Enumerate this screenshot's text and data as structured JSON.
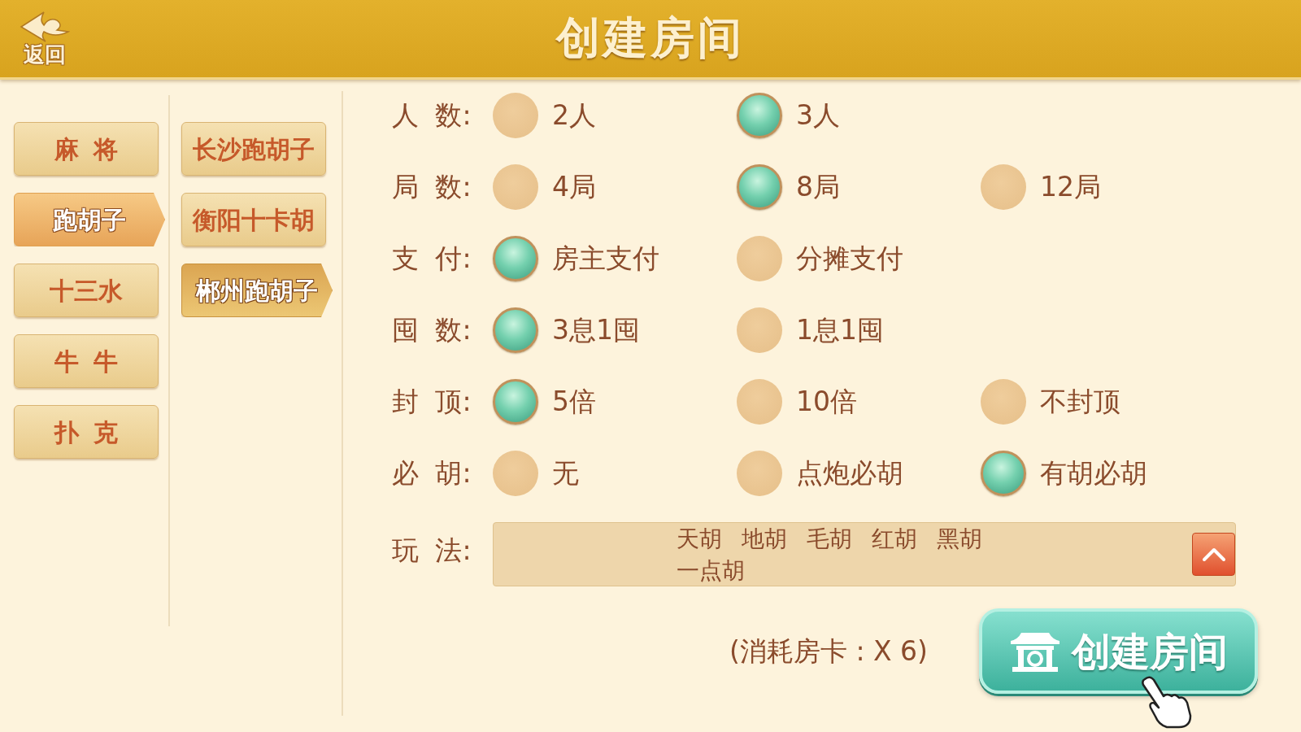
{
  "header": {
    "back_label": "返回",
    "title": "创建房间"
  },
  "categories": [
    {
      "label": "麻 将",
      "selected": false
    },
    {
      "label": "跑胡子",
      "selected": true
    },
    {
      "label": "十三水",
      "selected": false
    },
    {
      "label": "牛 牛",
      "selected": false
    },
    {
      "label": "扑 克",
      "selected": false
    }
  ],
  "variants": [
    {
      "label": "长沙跑胡子",
      "selected": false
    },
    {
      "label": "衡阳十卡胡",
      "selected": false
    },
    {
      "label": "郴州跑胡子",
      "selected": true
    }
  ],
  "options": [
    {
      "label": "人 数:",
      "choices": [
        {
          "label": "2人",
          "selected": false
        },
        {
          "label": "3人",
          "selected": true
        }
      ]
    },
    {
      "label": "局 数:",
      "choices": [
        {
          "label": "4局",
          "selected": false
        },
        {
          "label": "8局",
          "selected": true
        },
        {
          "label": "12局",
          "selected": false
        }
      ]
    },
    {
      "label": "支 付:",
      "choices": [
        {
          "label": "房主支付",
          "selected": true
        },
        {
          "label": "分摊支付",
          "selected": false
        }
      ]
    },
    {
      "label": "囤 数:",
      "choices": [
        {
          "label": "3息1囤",
          "selected": true
        },
        {
          "label": "1息1囤",
          "selected": false
        }
      ]
    },
    {
      "label": "封 顶:",
      "choices": [
        {
          "label": "5倍",
          "selected": true
        },
        {
          "label": "10倍",
          "selected": false
        },
        {
          "label": "不封顶",
          "selected": false
        }
      ]
    },
    {
      "label": "必 胡:",
      "choices": [
        {
          "label": "无",
          "selected": false
        },
        {
          "label": "点炮必胡",
          "selected": false
        },
        {
          "label": "有胡必胡",
          "selected": true
        }
      ]
    }
  ],
  "play_rules": {
    "label": "玩 法:",
    "items": [
      "天胡",
      "地胡",
      "毛胡",
      "红胡",
      "黑胡",
      "一点胡"
    ]
  },
  "cost_note": "(消耗房卡 : X 6)",
  "create_button": {
    "label": "创建房间"
  }
}
